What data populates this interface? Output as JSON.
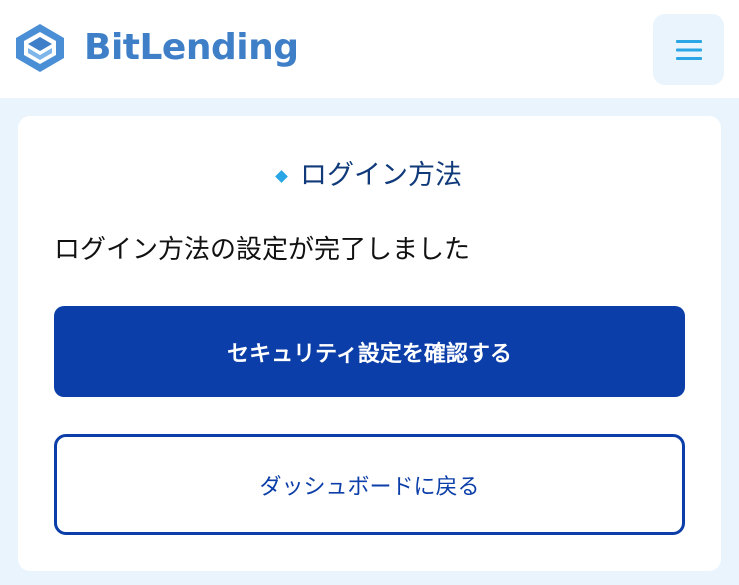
{
  "header": {
    "logo_text": "BitLending",
    "logo_icon": "bitlending-logo-icon",
    "menu_icon": "hamburger-menu-icon",
    "menu_symbol": "☰"
  },
  "card": {
    "heading": "ログイン方法",
    "message": "ログイン方法の設定が完了しました",
    "primary_button_label": "セキュリティ設定を確認する",
    "secondary_button_label": "ダッシュボードに戻る"
  },
  "colors": {
    "brand_blue": "#3e7fc8",
    "primary_button": "#0b3ea8",
    "accent": "#2aa6e6",
    "page_background": "#eaf4fd",
    "heading_text": "#103a7a"
  }
}
